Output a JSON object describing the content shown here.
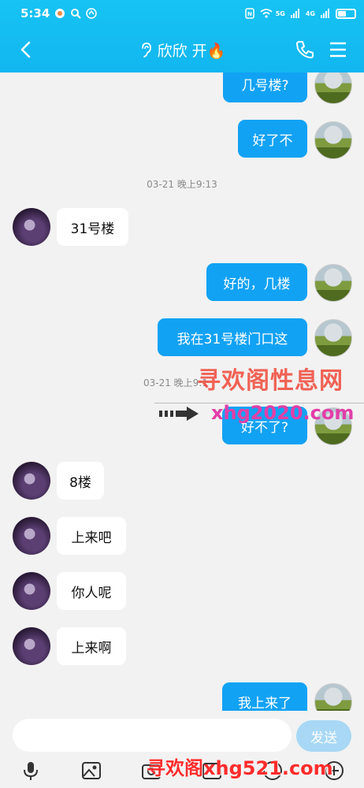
{
  "status": {
    "time": "5:34",
    "network": "5G",
    "signal_label": "4G"
  },
  "header": {
    "title": "欣欣 开🔥"
  },
  "messages": [
    {
      "side": "me",
      "text": "几号楼?"
    },
    {
      "side": "me",
      "text": "好了不"
    },
    {
      "side": "time",
      "text": "03-21 晚上9:13"
    },
    {
      "side": "them",
      "text": "31号楼"
    },
    {
      "side": "me",
      "text": "好的，几楼"
    },
    {
      "side": "me",
      "text": "我在31号楼门口这"
    },
    {
      "side": "time",
      "text": "03-21 晚上9:1"
    },
    {
      "side": "me",
      "text": "好不了?"
    },
    {
      "side": "them",
      "text": "8楼"
    },
    {
      "side": "them",
      "text": "上来吧"
    },
    {
      "side": "them",
      "text": "你人呢"
    },
    {
      "side": "them",
      "text": "上来啊"
    },
    {
      "side": "me",
      "text": "我上来了"
    }
  ],
  "watermark": {
    "text": "寻欢阁性息网",
    "url": "xhg2020.com",
    "bottom": "寻欢阁xhg521.com"
  },
  "input": {
    "placeholder": "",
    "send_label": "发送"
  },
  "toolbar": {
    "icons": [
      "microphone-icon",
      "image-icon",
      "camera-icon",
      "emoji-icon",
      "plus-icon"
    ]
  },
  "colors": {
    "header": "#16c3f3",
    "my_bubble": "#12a2f4",
    "send_disabled": "#a8d8f5"
  }
}
